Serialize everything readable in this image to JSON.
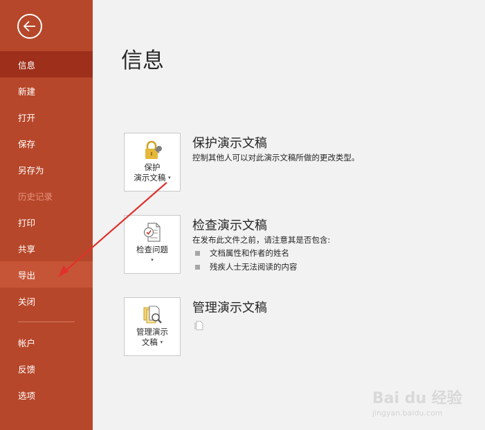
{
  "sidebar": {
    "items": [
      {
        "label": "信息"
      },
      {
        "label": "新建"
      },
      {
        "label": "打开"
      },
      {
        "label": "保存"
      },
      {
        "label": "另存为"
      },
      {
        "label": "历史记录"
      },
      {
        "label": "打印"
      },
      {
        "label": "共享"
      },
      {
        "label": "导出"
      },
      {
        "label": "关闭"
      },
      {
        "label": "帐户"
      },
      {
        "label": "反馈"
      },
      {
        "label": "选项"
      }
    ]
  },
  "main": {
    "title": "信息",
    "protect": {
      "button_line1": "保护",
      "button_line2": "演示文稿",
      "title": "保护演示文稿",
      "description": "控制其他人可以对此演示文稿所做的更改类型。"
    },
    "inspect": {
      "button_label": "检查问题",
      "title": "检查演示文稿",
      "description": "在发布此文件之前，请注意其是否包含:",
      "bullets": [
        "文档属性和作者的姓名",
        "残疾人士无法阅读的内容"
      ]
    },
    "manage": {
      "button_line1": "管理演示",
      "button_line2": "文稿",
      "title": "管理演示文稿"
    }
  },
  "watermark": {
    "text": "Bai du 经验",
    "url": "jingyan.baidu.com"
  },
  "colors": {
    "sidebar": "#b7472a",
    "selected": "#9e2f1b",
    "hover": "#c65537",
    "annotation_arrow": "#e0302b"
  }
}
